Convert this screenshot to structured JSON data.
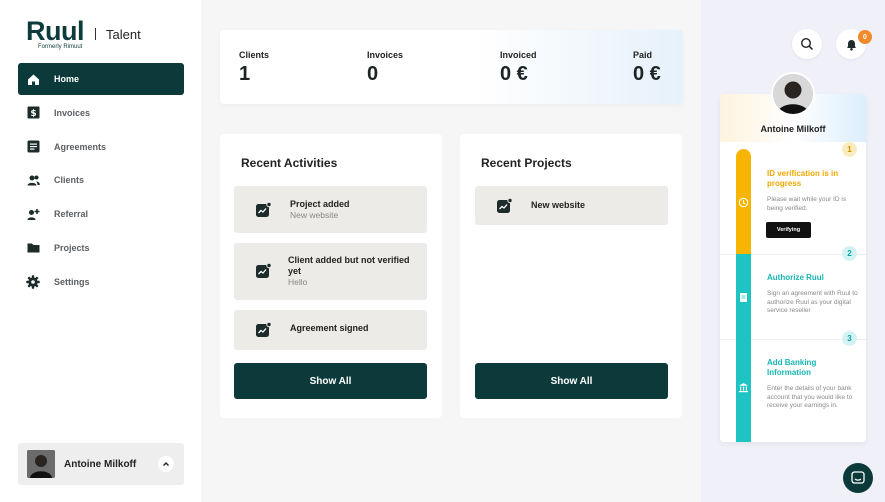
{
  "brand": {
    "name": "Ruul",
    "sub": "Formerly Rimuut",
    "product": "Talent"
  },
  "nav": [
    {
      "label": "Home",
      "icon": "home-icon",
      "active": true
    },
    {
      "label": "Invoices",
      "icon": "dollar-icon"
    },
    {
      "label": "Agreements",
      "icon": "document-icon"
    },
    {
      "label": "Clients",
      "icon": "users-icon"
    },
    {
      "label": "Referral",
      "icon": "referral-icon"
    },
    {
      "label": "Projects",
      "icon": "folder-icon"
    },
    {
      "label": "Settings",
      "icon": "gear-icon"
    }
  ],
  "user": {
    "name": "Antoine Milkoff"
  },
  "stats": [
    {
      "label": "Clients",
      "value": "1"
    },
    {
      "label": "Invoices",
      "value": "0"
    },
    {
      "label": "Invoiced",
      "value": "0 €"
    },
    {
      "label": "Paid",
      "value": "0 €"
    }
  ],
  "recent_activities": {
    "title": "Recent Activities",
    "items": [
      {
        "title": "Project added",
        "subtitle": "New website"
      },
      {
        "title": "Client added but not verified yet",
        "subtitle": "Hello"
      },
      {
        "title": "Agreement signed",
        "subtitle": ""
      }
    ],
    "show_all": "Show All"
  },
  "recent_projects": {
    "title": "Recent Projects",
    "items": [
      {
        "title": "New website"
      }
    ],
    "show_all": "Show All"
  },
  "notifications": {
    "count": "0"
  },
  "onboarding": {
    "name": "Antoine Milkoff",
    "steps": [
      {
        "num": "1",
        "title": "ID verification is in progress",
        "desc": "Please wait while your ID is being verified.",
        "button": "Verifying",
        "color": "#f7b500"
      },
      {
        "num": "2",
        "title": "Authorize Ruul",
        "desc": "Sign an agreement with Ruul to authorize Ruul as your digital service reseller",
        "color": "#1ec3c3"
      },
      {
        "num": "3",
        "title": "Add Banking Information",
        "desc": "Enter the details of your bank account that you would like to receive your earnings in.",
        "color": "#1ec3c3"
      }
    ]
  }
}
